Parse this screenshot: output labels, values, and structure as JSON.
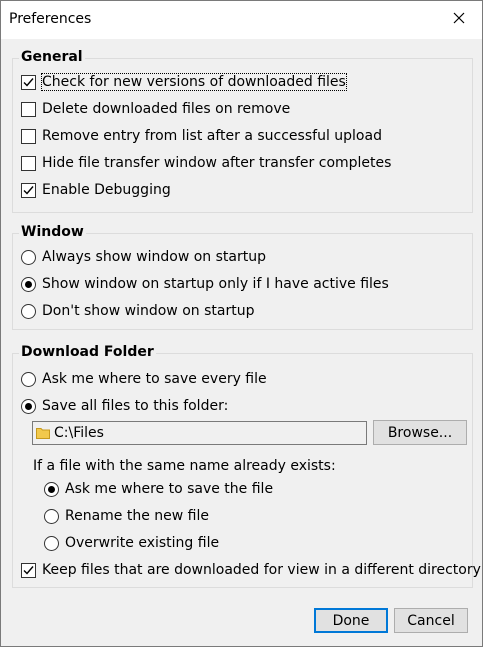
{
  "window": {
    "title": "Preferences"
  },
  "general": {
    "heading": "General",
    "options": [
      {
        "label": "Check for new versions of downloaded files",
        "checked": true
      },
      {
        "label": "Delete downloaded files on remove",
        "checked": false
      },
      {
        "label": "Remove entry from list after a successful upload",
        "checked": false
      },
      {
        "label": "Hide file transfer window after transfer completes",
        "checked": false
      },
      {
        "label": "Enable Debugging",
        "checked": true
      }
    ]
  },
  "window_group": {
    "heading": "Window",
    "options": [
      {
        "label": "Always show window on startup",
        "selected": false
      },
      {
        "label": "Show window on startup only if I have active files",
        "selected": true
      },
      {
        "label": "Don't show window on startup",
        "selected": false
      }
    ]
  },
  "download_folder": {
    "heading": "Download Folder",
    "options": [
      {
        "label": "Ask me where to save every file",
        "selected": false
      },
      {
        "label": "Save all files to this folder:",
        "selected": true
      }
    ],
    "folder_path": "C:\\Files",
    "browse_label": "Browse...",
    "same_name_prompt": "If a file with the same name already exists:",
    "same_name_options": [
      {
        "label": "Ask me where to save the file",
        "selected": true
      },
      {
        "label": "Rename the new file",
        "selected": false
      },
      {
        "label": "Overwrite existing file",
        "selected": false
      }
    ],
    "keep_files": {
      "label": "Keep files that are downloaded for view in a different directory",
      "checked": true
    }
  },
  "buttons": {
    "done": "Done",
    "cancel": "Cancel"
  }
}
